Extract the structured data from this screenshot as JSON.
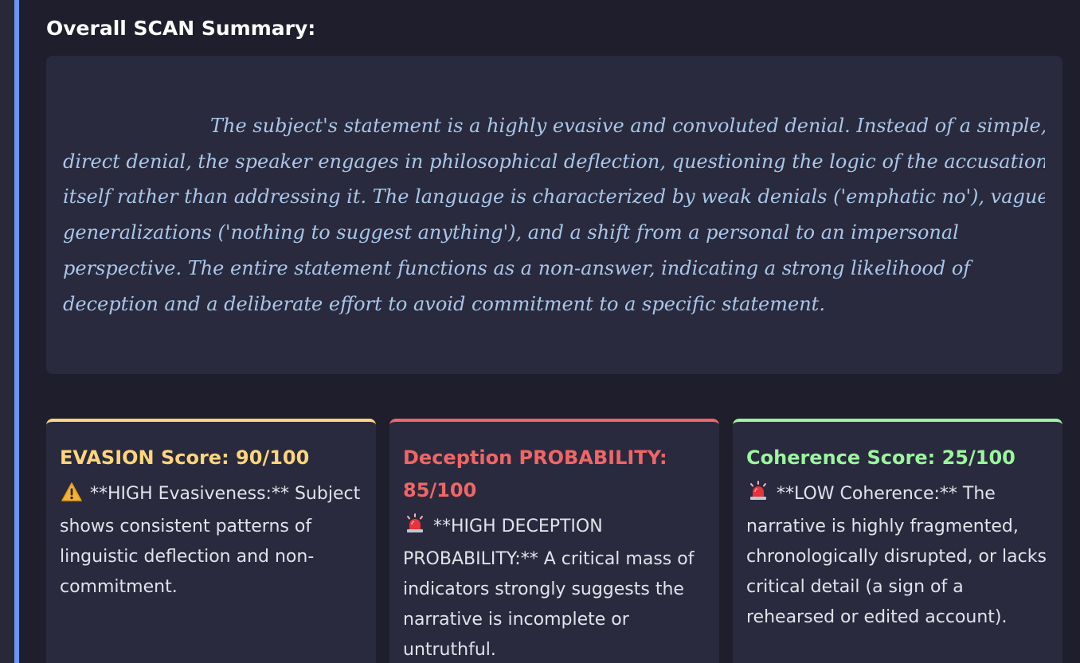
{
  "summary": {
    "title": "Overall SCAN Summary:",
    "lines": [
      "The subject's statement is a highly evasive and convoluted denial. Instead of a simple,",
      "direct denial, the speaker engages in philosophical deflection, questioning the logic of the accusation",
      "itself rather than addressing it. The language is characterized by weak denials ('emphatic no'), vague",
      "generalizations ('nothing to suggest anything'), and a shift from a personal to an impersonal",
      "perspective. The entire statement functions as a non-answer, indicating a strong likelihood of",
      "deception and a deliberate effort to avoid commitment to a specific statement."
    ]
  },
  "cards": [
    {
      "title_lines": [
        "EVASION Score: 90/100"
      ],
      "icon": "warning-icon",
      "body_lines": [
        "**HIGH Evasiveness:** Subject",
        "shows consistent patterns of",
        "linguistic deflection and non-",
        "commitment."
      ],
      "accent_color": "#fdd57c"
    },
    {
      "title_lines": [
        "Deception PROBABILITY:",
        "85/100"
      ],
      "icon": "siren-icon",
      "body_lines": [
        "**HIGH DECEPTION",
        "PROBABILITY:** A critical mass of",
        "indicators strongly suggests the",
        "narrative is incomplete or",
        "untruthful."
      ],
      "accent_color": "#f06666"
    },
    {
      "title_lines": [
        "Coherence Score: 25/100"
      ],
      "icon": "siren-icon",
      "body_lines": [
        "**LOW Coherence:** The",
        "narrative is highly fragmented,",
        "chronologically disrupted, or lacks",
        "critical detail (a sign of a",
        "rehearsed or edited account)."
      ],
      "accent_color": "#9cf59e"
    }
  ]
}
